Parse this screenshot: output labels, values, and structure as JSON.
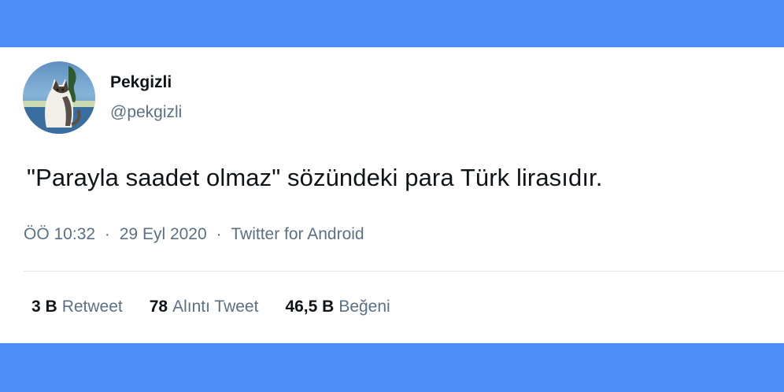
{
  "colors": {
    "background": "#4d8ef8",
    "card": "#ffffff",
    "primary_text": "#0f1419",
    "secondary_text": "#5b7083",
    "divider": "#e1e8ed"
  },
  "author": {
    "display_name": "Pekgizli",
    "handle": "@pekgizli",
    "avatar_icon": "cat-avatar"
  },
  "tweet": {
    "text": "\"Parayla saadet olmaz\" sözündeki para Türk lirasıdır.",
    "time": "ÖÖ 10:32",
    "separator": "·",
    "date": "29 Eyl 2020",
    "source": "Twitter for Android"
  },
  "stats": [
    {
      "value": "3 B",
      "label": "Retweet"
    },
    {
      "value": "78",
      "label": "Alıntı Tweet"
    },
    {
      "value": "46,5 B",
      "label": "Beğeni"
    }
  ]
}
